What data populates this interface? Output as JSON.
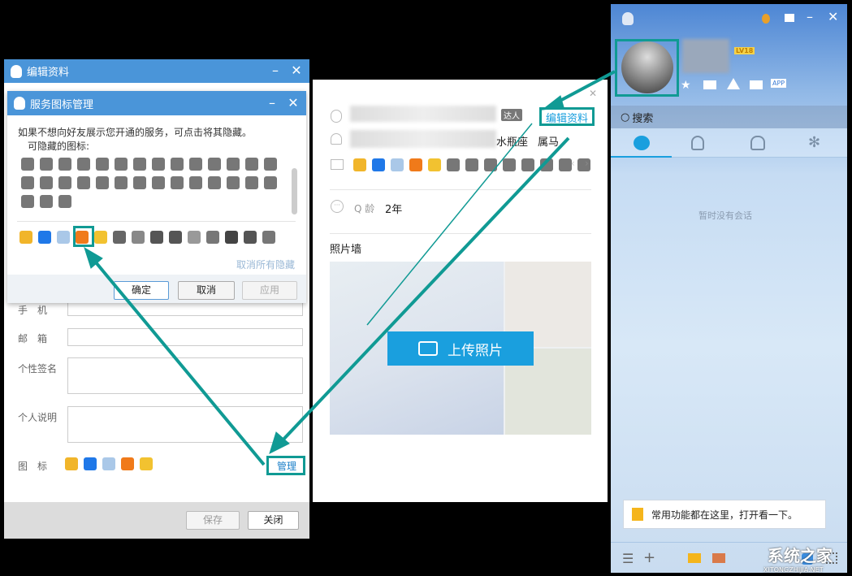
{
  "edit_dialog": {
    "title": "编辑资料",
    "minimize": "–",
    "close": "✕",
    "fields": [
      {
        "label": "手　机",
        "value": ""
      },
      {
        "label": "邮　箱",
        "value": ""
      },
      {
        "label": "个性签名",
        "value": ""
      },
      {
        "label": "个人说明",
        "value": ""
      }
    ],
    "icons_label": "图　标",
    "manage_link": "管理",
    "save": "保存",
    "close_button": "关闭",
    "icons": [
      {
        "name": "star-vip-icon",
        "color": "#f1b52a"
      },
      {
        "name": "qq-security-shield-icon",
        "color": "#1f78e8"
      },
      {
        "name": "mail-icon",
        "color": "#aac8e8"
      },
      {
        "name": "qq-music-icon",
        "color": "#f07a1a"
      },
      {
        "name": "yellow-badge-icon",
        "color": "#f2c230"
      }
    ]
  },
  "service_dialog": {
    "title": "服务图标管理",
    "minimize": "–",
    "close": "✕",
    "description": "如果不想向好友展示您开通的服务，可点击将其隐藏。",
    "hidden_label": "可隐藏的图标:",
    "hidden_icon_count_rows": [
      14,
      14,
      3
    ],
    "hidden_icon_color": "#777",
    "visible_icons": [
      {
        "name": "star-vip-icon",
        "color": "#f1b52a"
      },
      {
        "name": "qq-security-shield-icon",
        "color": "#1f78e8"
      },
      {
        "name": "mail-icon",
        "color": "#aac8e8"
      },
      {
        "name": "qq-music-icon",
        "color": "#f07a1a"
      },
      {
        "name": "yellow-badge-icon",
        "color": "#f2c230"
      },
      {
        "name": "app-icon",
        "color": "#666"
      },
      {
        "name": "camera-icon",
        "color": "#888"
      },
      {
        "name": "diamond-icon",
        "color": "#555"
      },
      {
        "name": "gift-icon",
        "color": "#555"
      },
      {
        "name": "webcam-icon",
        "color": "#999"
      },
      {
        "name": "video-icon",
        "color": "#777"
      },
      {
        "name": "night-icon",
        "color": "#444"
      },
      {
        "name": "cow-icon",
        "color": "#555"
      },
      {
        "name": "shield-icon",
        "color": "#777"
      }
    ],
    "unhide_all": "取消所有隐藏",
    "ok": "确定",
    "cancel": "取消",
    "apply": "应用"
  },
  "profile_card": {
    "expert_badge": "达人",
    "edit_profile": "编辑资料",
    "zodiac": "水瓶座",
    "chinese_zodiac": "属马",
    "q_age_label": "Q 龄",
    "q_age_value": "2年",
    "photo_wall": "照片墙",
    "upload_photo": "上传照片",
    "close": "✕"
  },
  "qq_main": {
    "level": "LV18",
    "search_placeholder": "搜索",
    "empty_sessions": "暂时没有会话",
    "tip": "常用功能都在这里，打开看一下。",
    "accent": "#1a9fde"
  },
  "watermark": {
    "text": "系统之家",
    "url_text": "XITONGZHIJIA.NET"
  }
}
